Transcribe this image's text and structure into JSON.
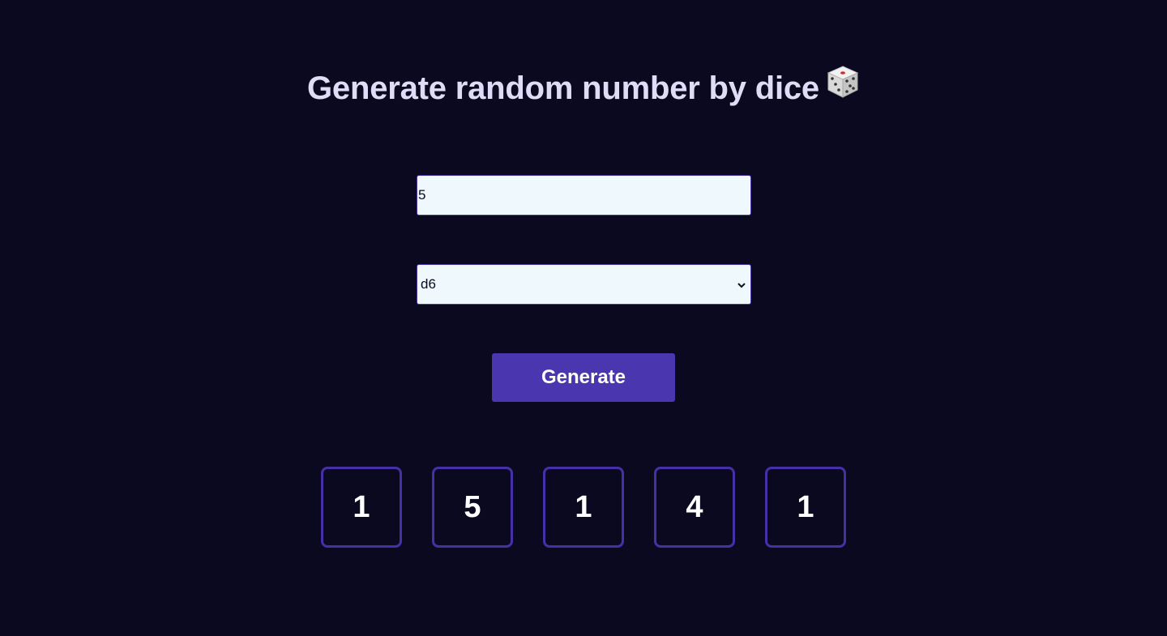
{
  "header": {
    "title": "Generate random number by dice",
    "icon": "die-icon"
  },
  "form": {
    "count_value": "5",
    "dice_type": {
      "selected": "d6"
    },
    "generate_label": "Generate"
  },
  "results": [
    "1",
    "5",
    "1",
    "4",
    "1"
  ],
  "colors": {
    "background": "#0b0920",
    "title": "#e0dcf7",
    "accent": "#4a37b0",
    "result_border": "#4530a6",
    "field_background": "#eff8fd"
  }
}
